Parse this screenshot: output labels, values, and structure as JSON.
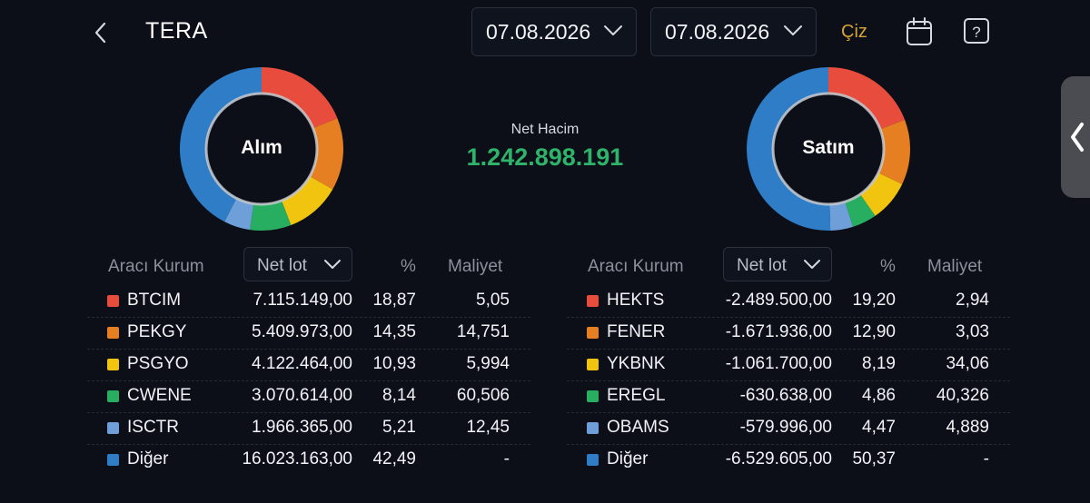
{
  "header": {
    "title": "TERA",
    "date_from": "07.08.2026",
    "date_to": "07.08.2026",
    "ciz_label": "Çiz"
  },
  "summary": {
    "net_label": "Net Hacim",
    "net_value": "1.242.898.191"
  },
  "colors": [
    "#e74c3c",
    "#e67e22",
    "#f1c40f",
    "#27ae60",
    "#6f9fd8",
    "#2f7dc7"
  ],
  "buy": {
    "label": "Alım",
    "columns": {
      "broker": "Aracı Kurum",
      "lot": "Net lot",
      "pct": "%",
      "cost": "Maliyet"
    },
    "rows": [
      {
        "name": "BTCIM",
        "lot": "7.115.149,00",
        "pct": "18,87",
        "cost": "5,05"
      },
      {
        "name": "PEKGY",
        "lot": "5.409.973,00",
        "pct": "14,35",
        "cost": "14,751"
      },
      {
        "name": "PSGYO",
        "lot": "4.122.464,00",
        "pct": "10,93",
        "cost": "5,994"
      },
      {
        "name": "CWENE",
        "lot": "3.070.614,00",
        "pct": "8,14",
        "cost": "60,506"
      },
      {
        "name": "ISCTR",
        "lot": "1.966.365,00",
        "pct": "5,21",
        "cost": "12,45"
      },
      {
        "name": "Diğer",
        "lot": "16.023.163,00",
        "pct": "42,49",
        "cost": "-"
      }
    ]
  },
  "sell": {
    "label": "Satım",
    "columns": {
      "broker": "Aracı Kurum",
      "lot": "Net lot",
      "pct": "%",
      "cost": "Maliyet"
    },
    "rows": [
      {
        "name": "HEKTS",
        "lot": "-2.489.500,00",
        "pct": "19,20",
        "cost": "2,94"
      },
      {
        "name": "FENER",
        "lot": "-1.671.936,00",
        "pct": "12,90",
        "cost": "3,03"
      },
      {
        "name": "YKBNK",
        "lot": "-1.061.700,00",
        "pct": "8,19",
        "cost": "34,06"
      },
      {
        "name": "EREGL",
        "lot": "-630.638,00",
        "pct": "4,86",
        "cost": "40,326"
      },
      {
        "name": "OBAMS",
        "lot": "-579.996,00",
        "pct": "4,47",
        "cost": "4,889"
      },
      {
        "name": "Diğer",
        "lot": "-6.529.605,00",
        "pct": "50,37",
        "cost": "-"
      }
    ]
  }
}
